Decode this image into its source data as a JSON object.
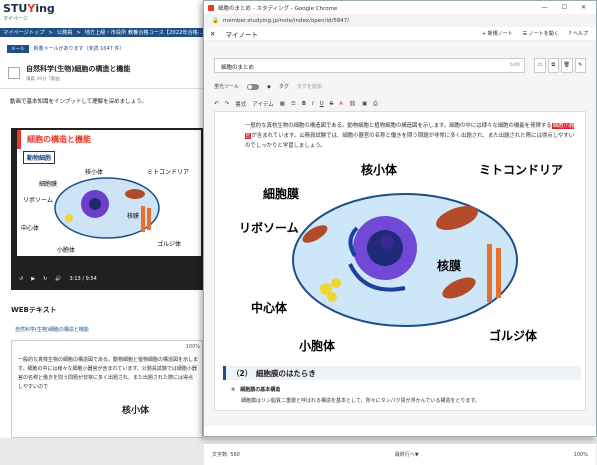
{
  "background": {
    "logo_main": "STU",
    "logo_accent": "Y",
    "logo_rest": "ing",
    "logo_sub": "マイページ",
    "breadcrumb": [
      "マイページトップ",
      "公務員",
      "地方上級・市役所 教養合格コース【2022年合格..."
    ],
    "mail_badge": "メール",
    "mail_text": "新着メールがあります（未読 1647 件）",
    "lesson_title": "自然科学(生物)細胞の構造と機能",
    "lesson_meta": "講義 49分 7動画",
    "lesson_desc": "動画で基本知識をインプットして理解を深めましょう。",
    "slide_heading": "細胞の構造と機能",
    "slide_box": "動物細胞",
    "slide_labels": [
      "核小体",
      "ミトコンドリア",
      "細胞膜",
      "リボソーム",
      "核膜",
      "中心体",
      "小胞体",
      "ゴルジ体"
    ],
    "video_time": "3:13 / 9:54",
    "web_heading": "WEBテキスト",
    "web_link": "自然科学(生物)細胞の構造と機能",
    "web_zoom": "100%",
    "web_text": "一般的な真核生物の細胞の構造図である。動物細胞と植物細胞の構造図を示します。細胞の中には様々な細胞小器官が含まれています。公務員試験では細胞小器官の名称と働きを問う問題が非常に多く出題され、また出題された際には得点しやすいので",
    "web_title": "核小体"
  },
  "window": {
    "title": "細胞のまとめ - スタディング - Google Chrome",
    "url": "member.studying.jp/note/index/open/id/5847/",
    "header_label": "マイノート",
    "new_note": "新規ノート",
    "open_note": "ノートを開く",
    "help": "ヘルプ",
    "note_title": "細胞のまとめ",
    "title_count": "5/40",
    "marker_tool": "蛍光ツール",
    "tag_label": "タグ",
    "tag_placeholder": "タグを追加",
    "toolbar": {
      "style": "書式",
      "item": "アイテム"
    },
    "paragraph": {
      "part1": "一般的な真核生物の細胞の構造図である。動物細胞と植物細胞の構造図を示します。細胞の中には様々な細胞の機能を発揮する",
      "highlight": "細胞小器官",
      "part2": "が含まれています。公務員試験では、細胞小器官の名称と働きを問う問題が非常に多く出題され、また出題された際には得点しやすいので",
      "part3": "しっかりと学習しましょう。"
    },
    "diagram_labels": {
      "nucleolus": "核小体",
      "mitochondria": "ミトコンドリア",
      "membrane": "細胞膜",
      "ribosome": "リボソーム",
      "nuclear_envelope": "核膜",
      "centrosome": "中心体",
      "er": "小胞体",
      "golgi": "ゴルジ体"
    },
    "section_heading": "（2）　細胞膜のはたらき",
    "sub_heading": "①　細胞膜の基本構造",
    "sub_text": "細胞膜はリン脂質二重層と呼ばれる構造を基本として、所々にタンパク質が浮かんでいる構造をとります。",
    "status_chars": "文字数: 560",
    "status_center": "最終行へ▼",
    "status_zoom": "100%",
    "colors": {
      "accent": "#e8382a",
      "brand": "#1e4f86"
    }
  }
}
